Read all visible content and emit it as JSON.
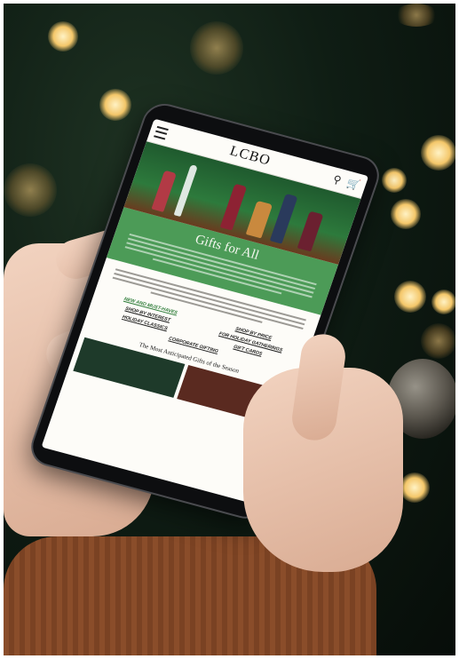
{
  "screen": {
    "logo": "LCBO",
    "panel_title": "Gifts for All",
    "links": [
      "NEW AND MUST-HAVES",
      "SHOP BY PRICE",
      "SHOP BY INTEREST",
      "FOR HOLIDAY GATHERINGS",
      "HOLIDAY CLASSICS",
      "GIFT CARDS",
      "CORPORATE GIFTING"
    ],
    "section_title": "The Most Anticipated Gifts of the Season"
  },
  "icons": [
    "menu-icon",
    "search-icon",
    "cart-icon"
  ],
  "colors": {
    "panel_green": "#4c9b57",
    "link_green": "#2f7d3a",
    "sleeve": "#8a4d2a"
  }
}
